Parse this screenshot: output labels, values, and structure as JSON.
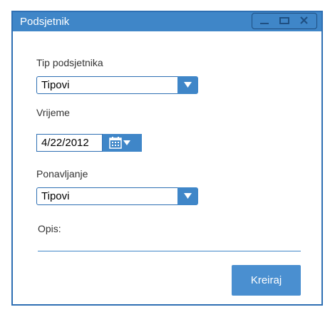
{
  "window": {
    "title": "Podsjetnik",
    "controls": [
      "minimize-icon",
      "maximize-icon",
      "close-icon"
    ]
  },
  "form": {
    "type_label": "Tip podsjetnika",
    "type_value": "Tipovi",
    "time_label": "Vrijeme",
    "date_value": "4/22/2012",
    "repeat_label": "Ponavljanje",
    "repeat_value": "Tipovi",
    "description_label": "Opis:",
    "description_value": "",
    "create_button": "Kreiraj"
  },
  "colors": {
    "accent": "#3f86c8",
    "border": "#2e6fb3",
    "button": "#4a8fd0"
  }
}
